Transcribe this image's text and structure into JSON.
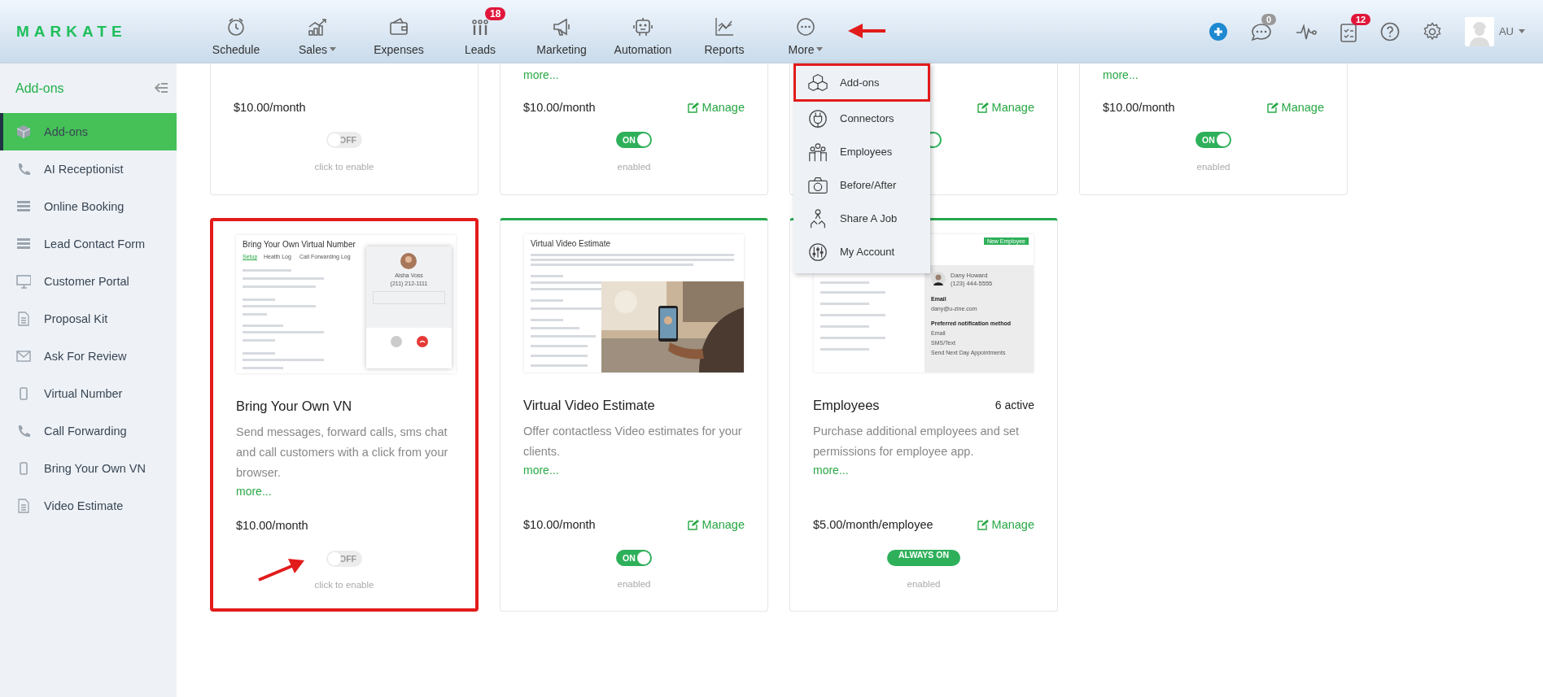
{
  "logo": "MARKATE",
  "nav": [
    {
      "label": "Schedule",
      "dropdown": false
    },
    {
      "label": "Sales",
      "dropdown": true
    },
    {
      "label": "Expenses",
      "dropdown": false
    },
    {
      "label": "Leads",
      "dropdown": false,
      "badge": "18"
    },
    {
      "label": "Marketing",
      "dropdown": false
    },
    {
      "label": "Automation",
      "dropdown": false
    },
    {
      "label": "Reports",
      "dropdown": false
    },
    {
      "label": "More",
      "dropdown": true
    }
  ],
  "toolbar": {
    "chat_badge": "0",
    "tasks_badge": "12",
    "user": "AU"
  },
  "sidebar": {
    "title": "Add-ons",
    "items": [
      {
        "label": "Add-ons",
        "selected": true
      },
      {
        "label": "AI Receptionist",
        "selected": false
      },
      {
        "label": "Online Booking",
        "selected": false
      },
      {
        "label": "Lead Contact Form",
        "selected": false
      },
      {
        "label": "Customer Portal",
        "selected": false
      },
      {
        "label": "Proposal Kit",
        "selected": false
      },
      {
        "label": "Ask For Review",
        "selected": false
      },
      {
        "label": "Virtual Number",
        "selected": false
      },
      {
        "label": "Call Forwarding",
        "selected": false
      },
      {
        "label": "Bring Your Own VN",
        "selected": false
      },
      {
        "label": "Video Estimate",
        "selected": false
      }
    ]
  },
  "upper_cards": [
    {
      "price": "$10.00/month",
      "on": false,
      "label": "OFF",
      "status": "click to enable"
    },
    {
      "more": "more...",
      "price": "$10.00/month",
      "manage": "Manage",
      "on": true,
      "label": "ON",
      "status": "enabled"
    },
    {
      "manage": "Manage",
      "on": true
    },
    {
      "more": "more...",
      "price": "$10.00/month",
      "manage": "Manage",
      "on": true,
      "label": "ON",
      "status": "enabled"
    }
  ],
  "cards": [
    {
      "highlighted": true,
      "title": "Bring Your Own VN",
      "description": "Send messages, forward calls, sms chat and call customers with a click from your browser.",
      "more": "more...",
      "price": "$10.00/month",
      "control": {
        "kind": "toggle",
        "on": false,
        "label": "OFF"
      },
      "status": "click to enable",
      "preview": {
        "kind": "call",
        "title": "Bring Your Own Virtual Number",
        "tabs": [
          "Setup",
          "Health Log",
          "Call Forwarding Log"
        ],
        "caller": "Aisha Voss",
        "phone": "(211) 212-1111"
      }
    },
    {
      "highlighted": false,
      "title": "Virtual Video Estimate",
      "description": "Offer contactless Video estimates for your clients.",
      "more": "more...",
      "price": "$10.00/month",
      "manage": "Manage",
      "control": {
        "kind": "toggle",
        "on": true,
        "label": "ON"
      },
      "status": "enabled",
      "preview": {
        "kind": "video",
        "title": "Virtual Video Estimate"
      }
    },
    {
      "highlighted": false,
      "title": "Employees",
      "count": "6 active",
      "description": "Purchase additional employees and set permissions for employee app.",
      "more": "more...",
      "price": "$5.00/month/employee",
      "manage": "Manage",
      "control": {
        "kind": "always",
        "on": true,
        "label": "ALWAYS ON"
      },
      "status": "enabled",
      "preview": {
        "kind": "employees",
        "button": "New Employee",
        "name": "Dany Howard",
        "phone": "(123) 444-5555",
        "details": [
          {
            "text": "Email",
            "bold": true
          },
          {
            "text": "dany@u-zine.com",
            "bold": false
          },
          {
            "text": "Preferred notification method",
            "bold": true
          },
          {
            "text": "Email",
            "bold": false
          },
          {
            "text": "SMS/Text",
            "bold": false
          },
          {
            "text": "Send Next Day Appointments",
            "bold": false
          }
        ]
      }
    }
  ],
  "more_menu": {
    "items": [
      {
        "label": "Add-ons",
        "highlighted": true
      },
      {
        "label": "Connectors",
        "highlighted": false
      },
      {
        "label": "Employees",
        "highlighted": false
      },
      {
        "label": "Before/After",
        "highlighted": false
      },
      {
        "label": "Share A Job",
        "highlighted": false
      },
      {
        "label": "My Account",
        "highlighted": false
      }
    ]
  }
}
